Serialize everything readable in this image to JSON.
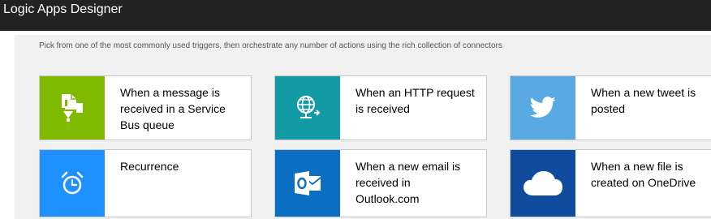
{
  "window": {
    "title": "Logic Apps Designer"
  },
  "designer": {
    "hint": "Pick from one of the most commonly used triggers, then orchestrate any number of actions using the rich collection of connectors"
  },
  "triggers": [
    {
      "label": "When a message is received in a Service Bus queue",
      "icon": "service-bus-icon",
      "color": "#7fba00"
    },
    {
      "label": "When an HTTP request is received",
      "icon": "http-globe-icon",
      "color": "#139ba5"
    },
    {
      "label": "When a new tweet is posted",
      "icon": "twitter-bird-icon",
      "color": "#59a9e3"
    },
    {
      "label": "Recurrence",
      "icon": "alarm-clock-icon",
      "color": "#1e90ff"
    },
    {
      "label": "When a new email is received in Outlook.com",
      "icon": "outlook-icon",
      "color": "#0a6fc2"
    },
    {
      "label": "When a new file is created on OneDrive",
      "icon": "onedrive-cloud-icon",
      "color": "#0f4c9e"
    }
  ]
}
